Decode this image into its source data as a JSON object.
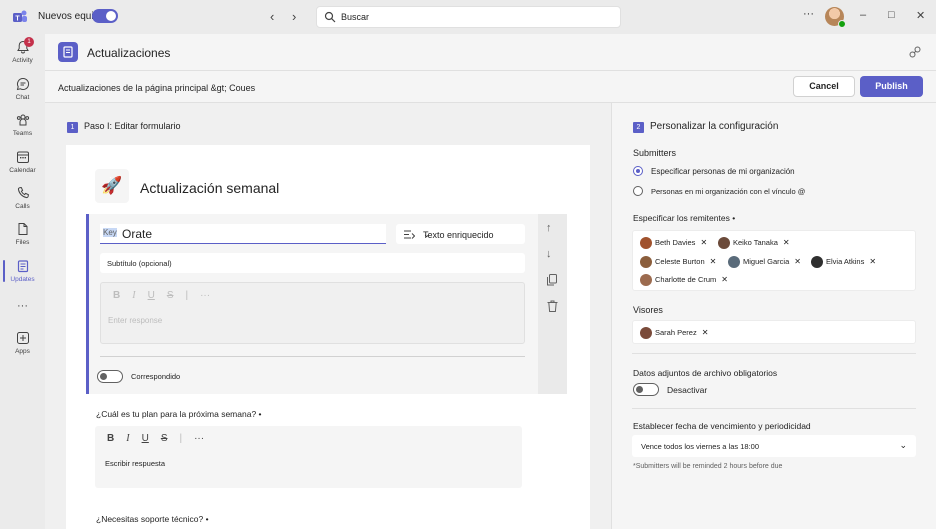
{
  "titlebar": {
    "new_teams_label": "Nuevos equipos",
    "search_placeholder": "Buscar",
    "more": "···",
    "minimize": "–",
    "maximize": "□",
    "close": "✕"
  },
  "rail": {
    "items": [
      {
        "label": "Activity",
        "badge": "1"
      },
      {
        "label": "Chat"
      },
      {
        "label": "Teams"
      },
      {
        "label": "Calendar"
      },
      {
        "label": "Calls"
      },
      {
        "label": "Files"
      },
      {
        "label": "Updates"
      },
      {
        "label": "···"
      },
      {
        "label": "Apps"
      }
    ]
  },
  "header": {
    "app_title": "Actualizaciones"
  },
  "crumbbar": {
    "breadcrumb": "Actualizaciones de la página principal &gt; Coues",
    "cancel_label": "Cancel",
    "publish_label": "Publish"
  },
  "left": {
    "step_number": "1",
    "step_title": "Paso I: Editar formulario",
    "form_title": "Actualización semanal",
    "question1": {
      "key_tag": "Key",
      "name": "Orate",
      "type": "Texto enriquecido",
      "subtitle": "Subtítulo (opcional)",
      "placeholder": "Enter response",
      "required_label": "Correspondido"
    },
    "question2": {
      "label": "¿Cuál es tu plan para la próxima semana? •",
      "placeholder": "Escribir respuesta"
    },
    "question3": {
      "label": "¿Necesitas soporte técnico? •"
    }
  },
  "right": {
    "step_number": "2",
    "step_title": "Personalizar la configuración",
    "submitters_label": "Submitters",
    "option1": "Especificar personas de mi organización",
    "option2": "Personas en mi organización con el vínculo @",
    "specify_label": "Especificar los remitentes •",
    "submitters": [
      "Beth Davies",
      "Keiko Tanaka",
      "Celeste Burton",
      "Miguel Garcia",
      "Elvia Atkins",
      "Charlotte de Crum"
    ],
    "viewers_label": "Visores",
    "viewers": [
      "Sarah Perez"
    ],
    "attachments_label": "Datos adjuntos de archivo obligatorios",
    "attachments_toggle": "Desactivar",
    "due_label": "Establecer fecha de vencimiento y periodicidad",
    "due_value": "Vence todos los viernes a las 18:00",
    "due_note": "*Submitters will be reminded 2 hours before due"
  },
  "colors": {
    "accent": "#5b5fc7"
  }
}
